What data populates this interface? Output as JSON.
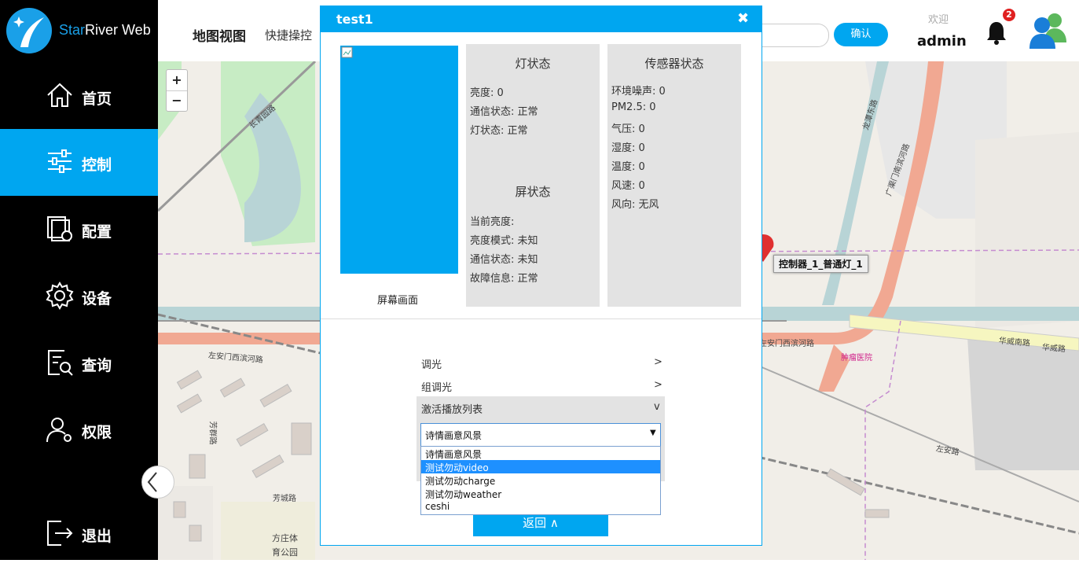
{
  "app": {
    "name_star": "Star",
    "name_rest": "River Web"
  },
  "sidebar": {
    "items": [
      {
        "label": "首页",
        "icon": "home-icon"
      },
      {
        "label": "控制",
        "icon": "sliders-icon",
        "active": true
      },
      {
        "label": "配置",
        "icon": "config-icon"
      },
      {
        "label": "设备",
        "icon": "gear-icon"
      },
      {
        "label": "查询",
        "icon": "query-icon"
      },
      {
        "label": "权限",
        "icon": "user-permission-icon"
      }
    ],
    "logout": {
      "label": "退出",
      "icon": "logout-icon"
    }
  },
  "header": {
    "title": "地图视图",
    "subtitle": "快捷操控",
    "confirm_label": "确认",
    "welcome": "欢迎",
    "username": "admin",
    "notification_count": "2"
  },
  "map": {
    "zoom_in": "+",
    "zoom_out": "−",
    "marker_label": "控制器_1_普通灯_1",
    "labels": [
      "长青园路",
      "左安门西滨河路",
      "方庄体",
      "育公园",
      "芳城路",
      "芳群路",
      "华威南路",
      "左安路",
      "肿瘤医院",
      "广渠门南滨河路",
      "龙潭东路",
      "左安门西滨河路",
      "华威路"
    ]
  },
  "modal": {
    "title": "test1",
    "close": "✖",
    "screen_label": "屏幕画面",
    "light_status": {
      "title": "灯状态",
      "rows": [
        "亮度: 0",
        "通信状态: 正常",
        "灯状态: 正常"
      ]
    },
    "screen_status": {
      "title": "屏状态",
      "rows": [
        "当前亮度:",
        "亮度模式: 未知",
        "通信状态: 未知",
        "故障信息: 正常"
      ]
    },
    "sensor_status": {
      "title": "传感器状态",
      "rows": [
        "环境噪声: 0",
        "PM2.5: 0",
        "气压: 0",
        "湿度: 0",
        "温度: 0",
        "风速: 0",
        "风向: 无风"
      ]
    },
    "menu": [
      {
        "label": "调光",
        "arrow": ">"
      },
      {
        "label": "组调光",
        "arrow": ">"
      },
      {
        "label": "激活播放列表",
        "arrow": "v"
      }
    ],
    "select": {
      "value": "诗情画意风景",
      "caret": "▼",
      "options": [
        "诗情画意风景",
        "测试勿动video",
        "测试勿动charge",
        "测试勿动weather",
        "ceshi"
      ],
      "highlighted_index": 1
    },
    "back_label": "返回 ∧"
  },
  "colors": {
    "accent": "#00a6f0",
    "sidebar_bg": "#000000",
    "panel_bg": "#e3e3e3"
  }
}
